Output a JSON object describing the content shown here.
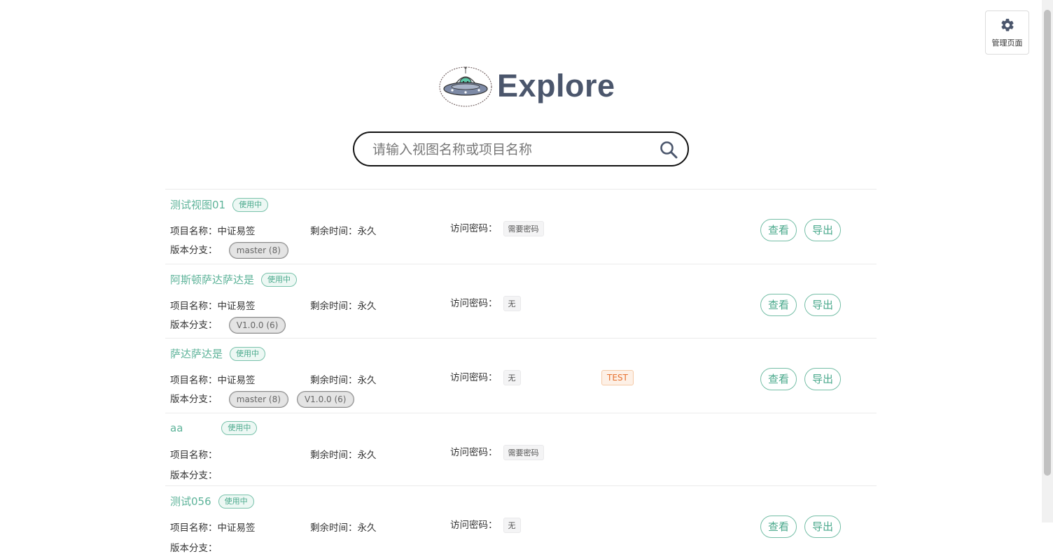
{
  "admin": {
    "label": "管理页面",
    "icon": "gear-icon"
  },
  "header": {
    "title": "Explore",
    "logo": "ufo-alien-logo"
  },
  "search": {
    "placeholder": "请输入视图名称或项目名称",
    "value": "",
    "icon": "search-icon"
  },
  "labels": {
    "project": "项目名称：",
    "remaining": "剩余时间：",
    "password": "访问密码：",
    "branch": "版本分支：",
    "view_button": "查看",
    "export_button": "导出"
  },
  "colors": {
    "accent": "#5db399",
    "title": "#4b566c",
    "test_tag": "#e6702e"
  },
  "views": [
    {
      "name": "测试视图01",
      "status": "使用中",
      "project": "中证易签",
      "remaining": "永久",
      "password": "需要密码",
      "tag": "",
      "branches": [
        "master (8)"
      ],
      "actions": true
    },
    {
      "name": "阿斯顿萨达萨达是",
      "status": "使用中",
      "project": "中证易签",
      "remaining": "永久",
      "password": "无",
      "tag": "",
      "branches": [
        "V1.0.0 (6)"
      ],
      "actions": true
    },
    {
      "name": "萨达萨达是",
      "status": "使用中",
      "project": "中证易签",
      "remaining": "永久",
      "password": "无",
      "tag": "TEST",
      "branches": [
        "master (8)",
        "V1.0.0 (6)"
      ],
      "actions": true
    },
    {
      "name": "aa",
      "status": "使用中",
      "project": "",
      "remaining": "永久",
      "password": "需要密码",
      "tag": "",
      "branches": [],
      "actions": false
    },
    {
      "name": "测试056",
      "status": "使用中",
      "project": "中证易签",
      "remaining": "永久",
      "password": "无",
      "tag": "",
      "branches": [],
      "actions": true
    }
  ]
}
